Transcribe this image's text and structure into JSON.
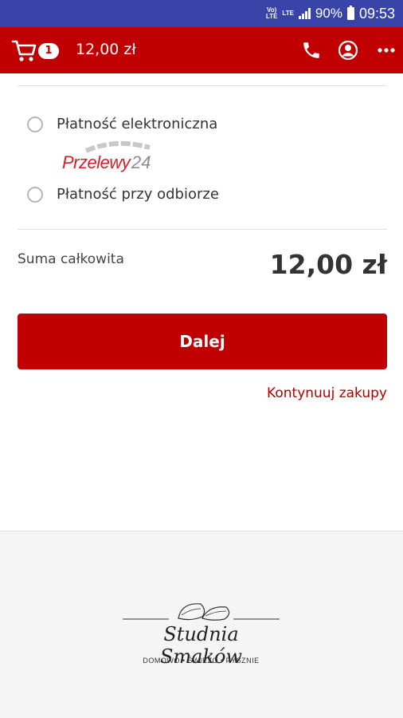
{
  "status_bar": {
    "network_1": "VoLTE",
    "network_2": "LTE",
    "battery": "90%",
    "time": "09:53"
  },
  "app_bar": {
    "cart_count": "1",
    "cart_total": "12,00 zł",
    "icons": [
      "cart-icon",
      "phone-icon",
      "account-icon",
      "more-icon"
    ]
  },
  "payment": {
    "options": [
      {
        "label": "Płatność elektroniczna",
        "provider_logo": "Przelewy24",
        "selected": false
      },
      {
        "label": "Płatność przy odbiorze",
        "selected": false
      }
    ]
  },
  "summary": {
    "label": "Suma całkowita",
    "value": "12,00 zł"
  },
  "actions": {
    "next_label": "Dalej",
    "continue_label": "Kontynuuj zakupy"
  },
  "footer": {
    "brand": "Studnia Smaków",
    "tagline": "DOMOWO • ŚWIEŻO • PYSZNIE"
  },
  "colors": {
    "status_bar": "#3944a8",
    "brand_red": "#c00000",
    "link_red": "#b00000",
    "footer_bg": "#f5f5f5"
  }
}
